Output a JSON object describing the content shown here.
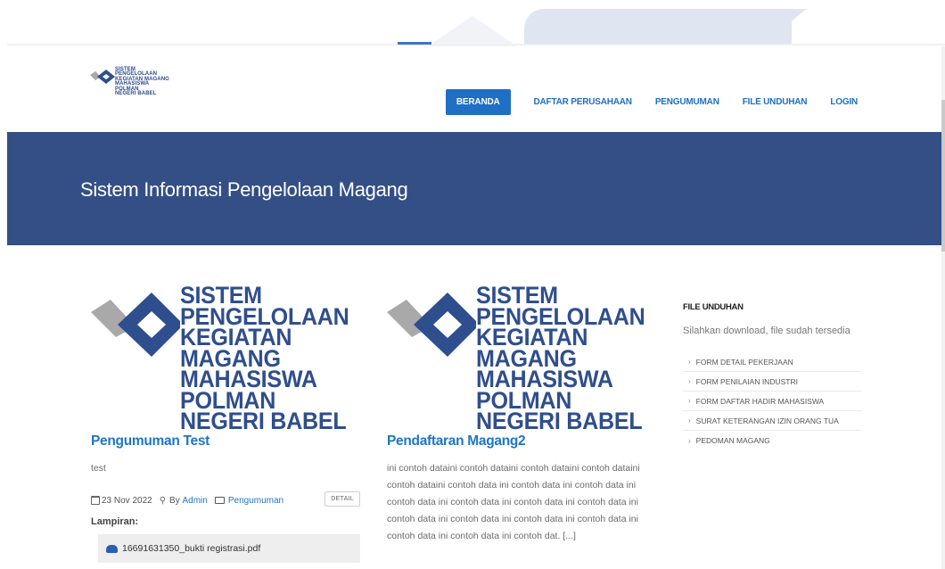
{
  "brand": {
    "logo_lines": [
      "SISTEM",
      "PENGELOLAAN",
      "KEGIATAN MAGANG",
      "MAHASISWA",
      "POLMAN",
      "NEGERI BABEL"
    ],
    "logo_colors": {
      "blue": "#2f4e8d",
      "gray": "#a9a9a9"
    }
  },
  "nav": {
    "items": [
      {
        "label": "BERANDA",
        "active": true
      },
      {
        "label": "DAFTAR PERUSAHAAN",
        "active": false
      },
      {
        "label": "PENGUMUMAN",
        "active": false
      },
      {
        "label": "FILE UNDUHAN",
        "active": false
      },
      {
        "label": "LOGIN",
        "active": false
      }
    ]
  },
  "banner": {
    "title": "Sistem Informasi Pengelolaan Magang",
    "color": "#344f85"
  },
  "posts": [
    {
      "title": "Pengumuman Test",
      "excerpt": "test",
      "date": "23 Nov 2022",
      "by_prefix": "By",
      "author": "Admin",
      "category": "Pengumuman",
      "detail_label": "DETAIL",
      "attachments_label": "Lampiran:",
      "attachment": "16691631350_bukti registrasi.pdf"
    },
    {
      "title": "Pendaftaran Magang2",
      "excerpt": "ini contoh dataini contoh dataini contoh dataini contoh dataini contoh dataini contoh data ini contoh data ini contoh data ini contoh data ini contoh data ini contoh data ini contoh data ini contoh data ini contoh data ini contoh data ini contoh data ini contoh data ini contoh data ini contoh dat. [...]"
    }
  ],
  "sidebar": {
    "heading": "FILE UNDUHAN",
    "description": "Silahkan download, file sudah tersedia",
    "files": [
      "FORM DETAIL PEKERJAAN",
      "FORM PENILAIAN INDUSTRI",
      "FORM DAFTAR HADIR MAHASISWA",
      "SURAT KETERANGAN IZIN ORANG TUA",
      "PEDOMAN MAGANG"
    ]
  },
  "colors": {
    "accent": "#1f6fc4",
    "link": "#1f75c5"
  }
}
